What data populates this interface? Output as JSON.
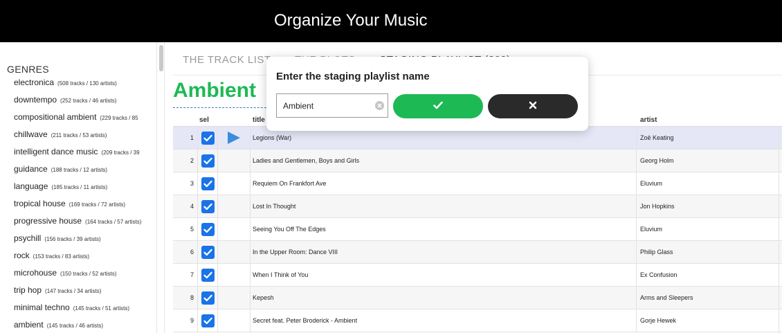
{
  "app": {
    "title": "Organize Your Music"
  },
  "sidebar": {
    "heading": "GENRES",
    "genres": [
      {
        "name": "electronica",
        "meta": "(508 tracks / 130 artists)"
      },
      {
        "name": "downtempo",
        "meta": "(252 tracks / 46 artists)"
      },
      {
        "name": "compositional ambient",
        "meta": "(229 tracks / 85"
      },
      {
        "name": "chillwave",
        "meta": "(211 tracks / 53 artists)"
      },
      {
        "name": "intelligent dance music",
        "meta": "(209 tracks / 39"
      },
      {
        "name": "guidance",
        "meta": "(188 tracks / 12 artists)"
      },
      {
        "name": "language",
        "meta": "(185 tracks / 11 artists)"
      },
      {
        "name": "tropical house",
        "meta": "(169 tracks / 72 artists)"
      },
      {
        "name": "progressive house",
        "meta": "(164 tracks / 57 artists)"
      },
      {
        "name": "psychill",
        "meta": "(156 tracks / 39 artists)"
      },
      {
        "name": "rock",
        "meta": "(153 tracks / 83 artists)"
      },
      {
        "name": "microhouse",
        "meta": "(150 tracks / 52 artists)"
      },
      {
        "name": "trip hop",
        "meta": "(147 tracks / 34 artists)"
      },
      {
        "name": "minimal techno",
        "meta": "(145 tracks / 51 artists)"
      },
      {
        "name": "ambient",
        "meta": "(145 tracks / 46 artists)"
      }
    ]
  },
  "tabs": [
    {
      "label": "THE TRACK LIST"
    },
    {
      "label": "THE PLOTS"
    },
    {
      "label": "STAGING PLAYLIST (209)"
    }
  ],
  "playlist": {
    "title": "Ambient"
  },
  "table": {
    "headers": {
      "sel": "sel",
      "title": "title",
      "artist": "artist"
    },
    "rows": [
      {
        "num": "1",
        "title": "Legions (War)",
        "artist": "Zoë Keating",
        "checked": true
      },
      {
        "num": "2",
        "title": "Ladies and Gentlemen, Boys and Girls",
        "artist": "Georg Holm",
        "checked": true
      },
      {
        "num": "3",
        "title": "Requiem On Frankfort Ave",
        "artist": "Eluvium",
        "checked": true
      },
      {
        "num": "4",
        "title": "Lost In Thought",
        "artist": "Jon Hopkins",
        "checked": true
      },
      {
        "num": "5",
        "title": "Seeing You Off The Edges",
        "artist": "Eluvium",
        "checked": true
      },
      {
        "num": "6",
        "title": "In the Upper Room: Dance VIII",
        "artist": "Philip Glass",
        "checked": true
      },
      {
        "num": "7",
        "title": "When I Think of You",
        "artist": "Ex Confusion",
        "checked": true
      },
      {
        "num": "8",
        "title": "Kepesh",
        "artist": "Arms and Sleepers",
        "checked": true
      },
      {
        "num": "9",
        "title": "Secret feat. Peter Broderick - Ambient",
        "artist": "Gorje Hewek",
        "checked": true
      }
    ]
  },
  "dialog": {
    "title": "Enter the staging playlist name",
    "input_value": "Ambient",
    "confirm_icon": "check-icon",
    "cancel_icon": "close-icon"
  },
  "colors": {
    "brand_green": "#1db954",
    "checkbox_blue": "#1a73e8",
    "play_blue": "#3b8ddb",
    "highlight_row": "#e5e7f7",
    "cancel_dark": "#2a2a2a"
  }
}
